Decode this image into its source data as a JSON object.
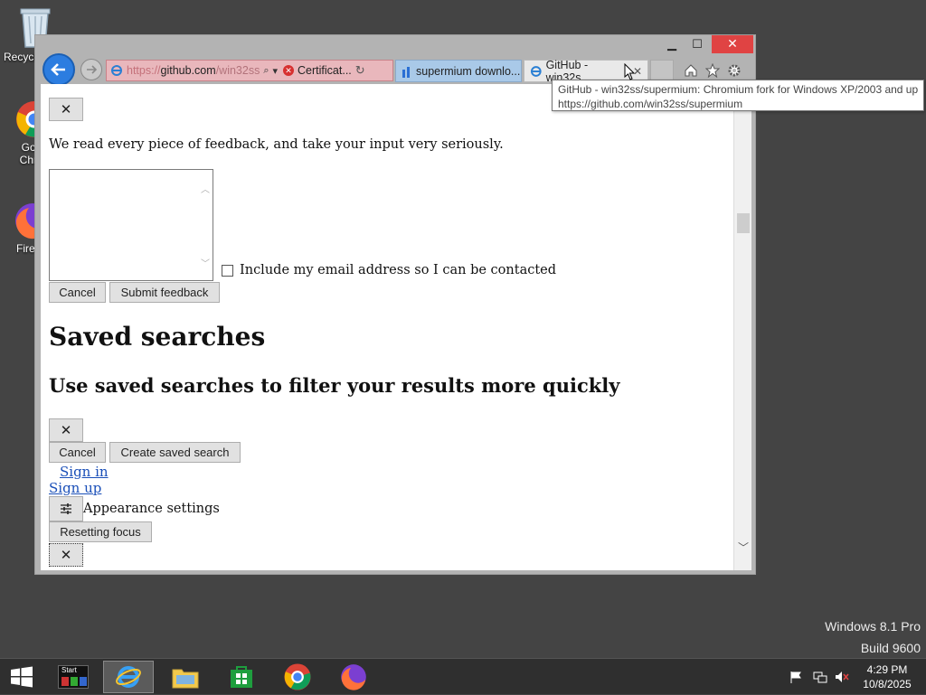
{
  "desktop": {
    "icons": [
      {
        "label": "Recycle Bin"
      },
      {
        "label": "Google Chrome"
      },
      {
        "label": "Firefox"
      }
    ]
  },
  "browser": {
    "address": {
      "protocol": "https://",
      "host": "github.com",
      "path": "/win32ss",
      "cert_label": "Certificat..."
    },
    "tabs": [
      {
        "title": "supermium downlo..."
      },
      {
        "title": "GitHub - win32s..."
      }
    ],
    "tooltip": {
      "line1": "GitHub - win32ss/supermium: Chromium fork for Windows XP/2003 and up",
      "line2": "https://github.com/win32ss/supermium"
    }
  },
  "page": {
    "close_glyph": "✕",
    "feedback_text": "We read every piece of feedback, and take your input very seriously.",
    "include_email_label": "Include my email address so I can be contacted",
    "cancel_label": "Cancel",
    "submit_feedback_label": "Submit feedback",
    "saved_searches_heading": "Saved searches",
    "saved_searches_sub": "Use saved searches to filter your results more quickly",
    "create_saved_search_label": "Create saved search",
    "sign_in": "Sign in",
    "sign_up": "Sign up",
    "appearance_settings": "Appearance settings",
    "resetting_focus": "Resetting focus"
  },
  "watermark": {
    "line1": "Windows 8.1 Pro",
    "line2": "Build 9600"
  },
  "taskbar": {
    "start_label": "Start",
    "time": "4:29 PM",
    "date": "10/8/2025"
  },
  "colors": {
    "desktop": "#444444",
    "address_error": "#e9b7bc",
    "close_red": "#e04343",
    "link": "#1a4fb8"
  }
}
